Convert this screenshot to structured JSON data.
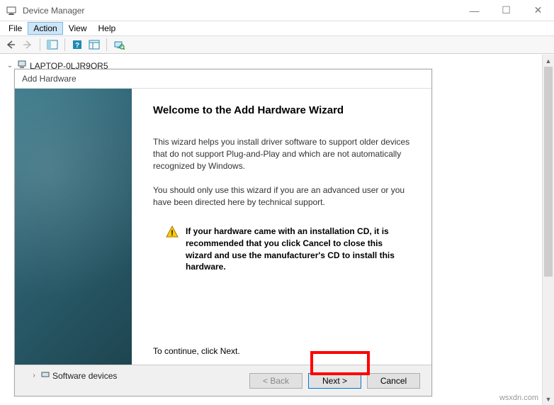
{
  "window": {
    "title": "Device Manager",
    "controls": {
      "min": "—",
      "max": "☐",
      "close": "✕"
    }
  },
  "menu": {
    "file": "File",
    "action": "Action",
    "view": "View",
    "help": "Help"
  },
  "tree": {
    "root": "LAPTOP-0LJR9OR5",
    "child1": "Software devices"
  },
  "dialog": {
    "header": "Add Hardware",
    "title": "Welcome to the Add Hardware Wizard",
    "p1": "This wizard helps you install driver software to support older devices that do not support Plug-and-Play and which are not automatically recognized by Windows.",
    "p2": "You should only use this wizard if you are an advanced user or you have been directed here by technical support.",
    "warning": "If your hardware came with an installation CD, it is recommended that you click Cancel to close this wizard and use the manufacturer's CD to install this hardware.",
    "continue": "To continue, click Next.",
    "buttons": {
      "back": "< Back",
      "next": "Next >",
      "cancel": "Cancel"
    }
  },
  "watermark": "wsxdn.com"
}
